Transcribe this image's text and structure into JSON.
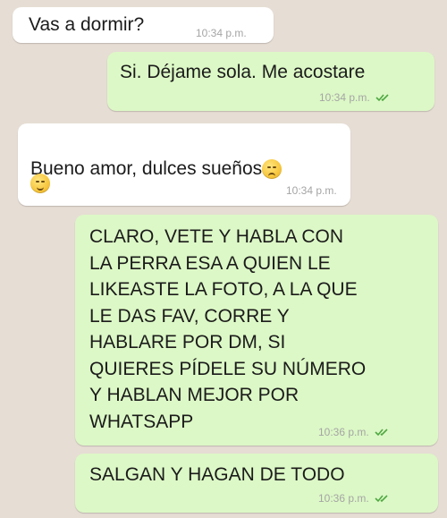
{
  "messages": [
    {
      "direction": "incoming",
      "text": "Vas a dormir?",
      "time": "10:34 p.m."
    },
    {
      "direction": "outgoing",
      "text": "Si. Déjame sola. Me acostare",
      "time": "10:34 p.m."
    },
    {
      "direction": "incoming",
      "text": "Bueno amor, dulces sueños",
      "time": "10:34 p.m.",
      "emojis": [
        "sad-face-emoji",
        "smile-emoji"
      ]
    },
    {
      "direction": "outgoing",
      "text": "CLARO, VETE Y HABLA CON\nLA PERRA ESA A QUIEN LE\nLIKEASTE LA FOTO, A LA QUE\nLE DAS FAV, CORRE Y\nHABLARE POR DM, SI\nQUIERES PÍDELE SU NÚMERO\nY HABLAN MEJOR POR\nWHATSAPP",
      "time": "10:36 p.m."
    },
    {
      "direction": "outgoing",
      "text": "SALGAN Y HAGAN DE TODO",
      "time": "10:36 p.m."
    }
  ],
  "colors": {
    "background": "#e6ddd4",
    "incoming_bubble": "#ffffff",
    "outgoing_bubble": "#dcf8c6",
    "read_ticks": "#4fa842"
  }
}
